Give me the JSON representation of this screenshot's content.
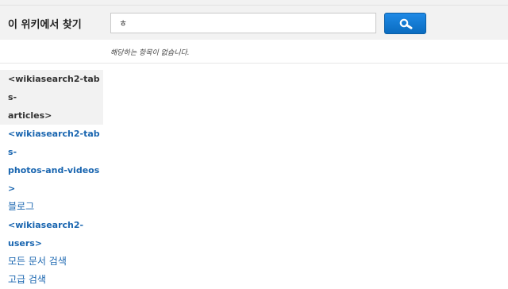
{
  "search": {
    "title": "이 위키에서 찾기",
    "query": "ㅎ",
    "button_icon": "search-icon"
  },
  "results": {
    "message": "해당하는 항목이 없습니다."
  },
  "sidebar": {
    "items": [
      {
        "line1": "<wikiasearch2-tabs-",
        "line2": "articles>",
        "active": true
      },
      {
        "line1": "<wikiasearch2-tabs-",
        "line2": "photos-and-videos>",
        "active": false
      },
      {
        "line1": "블로그",
        "active": false
      },
      {
        "line1": "<wikiasearch2-",
        "line2": "users>",
        "active": false
      },
      {
        "line1": "모든 문서 검색",
        "active": false
      },
      {
        "line1": "고급 검색",
        "active": false
      }
    ]
  },
  "colors": {
    "link": "#1a66b0",
    "button": "#0a6cc0",
    "band": "#f2f2f2"
  }
}
